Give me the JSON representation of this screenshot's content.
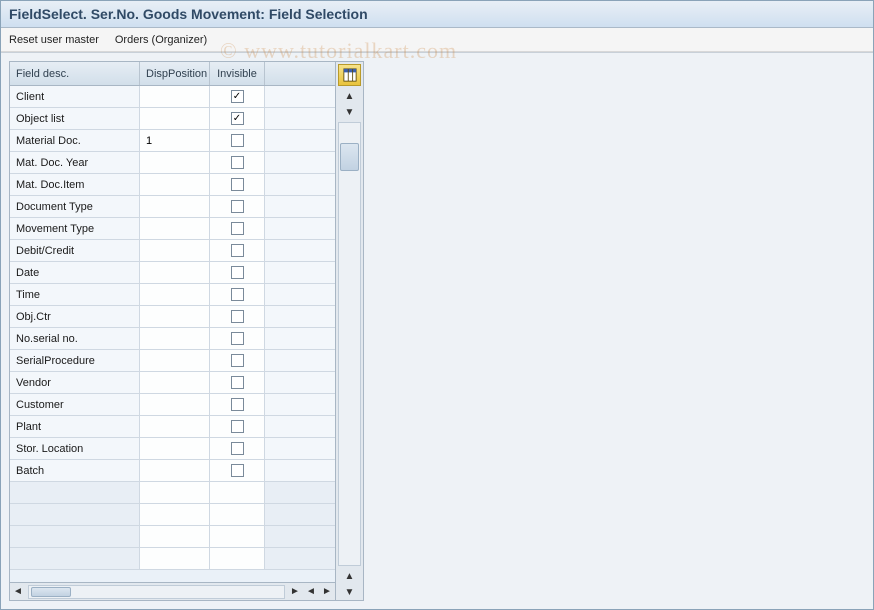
{
  "header": {
    "title": "FieldSelect. Ser.No. Goods Movement: Field Selection"
  },
  "toolbar": {
    "reset_user_master": "Reset user master",
    "orders_organizer": "Orders (Organizer)"
  },
  "grid": {
    "columns": {
      "field_desc": "Field desc.",
      "disp_position": "DispPosition",
      "invisible": "Invisible"
    },
    "rows": [
      {
        "desc": "Client",
        "pos": "",
        "invisible": true
      },
      {
        "desc": "Object list",
        "pos": "",
        "invisible": true
      },
      {
        "desc": "Material Doc.",
        "pos": "1",
        "invisible": false
      },
      {
        "desc": "Mat. Doc. Year",
        "pos": "",
        "invisible": false
      },
      {
        "desc": "Mat. Doc.Item",
        "pos": "",
        "invisible": false
      },
      {
        "desc": "Document Type",
        "pos": "",
        "invisible": false
      },
      {
        "desc": "Movement Type",
        "pos": "",
        "invisible": false
      },
      {
        "desc": "Debit/Credit",
        "pos": "",
        "invisible": false
      },
      {
        "desc": "Date",
        "pos": "",
        "invisible": false
      },
      {
        "desc": "Time",
        "pos": "",
        "invisible": false
      },
      {
        "desc": "Obj.Ctr",
        "pos": "",
        "invisible": false
      },
      {
        "desc": "No.serial no.",
        "pos": "",
        "invisible": false
      },
      {
        "desc": "SerialProcedure",
        "pos": "",
        "invisible": false
      },
      {
        "desc": "Vendor",
        "pos": "",
        "invisible": false
      },
      {
        "desc": "Customer",
        "pos": "",
        "invisible": false
      },
      {
        "desc": "Plant",
        "pos": "",
        "invisible": false
      },
      {
        "desc": "Stor. Location",
        "pos": "",
        "invisible": false
      },
      {
        "desc": "Batch",
        "pos": "",
        "invisible": false
      }
    ],
    "empty_rows": 4
  },
  "watermark": "© www.tutorialkart.com"
}
